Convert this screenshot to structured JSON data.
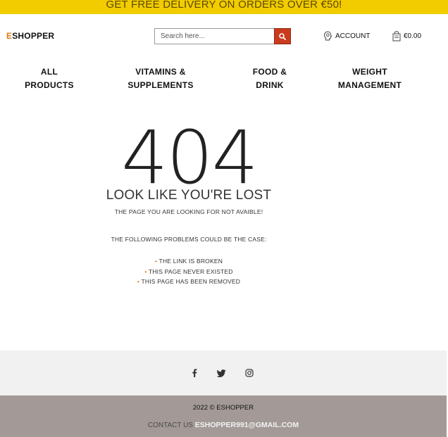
{
  "promo": {
    "text": "GET FREE DELIVERY ON ORDERS OVER €50!"
  },
  "header": {
    "logo_first": "E",
    "logo_rest": "SHOPPER",
    "search_placeholder": "Search here...",
    "search_icon": "magnifier-icon",
    "account_label": "ACCOUNT",
    "account_icon": "account-icon",
    "cart_total": "€0.00",
    "cart_icon": "cart-icon"
  },
  "nav": {
    "items": [
      {
        "line1": "ALL",
        "line2": "PRODUCTS"
      },
      {
        "line1": "VITAMINS &",
        "line2": "SUPPLEMENTS"
      },
      {
        "line1": "FOOD &",
        "line2": "DRINK"
      },
      {
        "line1": "WEIGHT",
        "line2": "MANAGEMENT"
      }
    ]
  },
  "error": {
    "code": "404",
    "title": "LOOK LIKE YOU'RE LOST",
    "subtitle": "THE PAGE YOU ARE LOOKING FOR NOT AVAIBLE!",
    "problems_heading": "THE FOLLOWING PROBLEMS COULD BE THE CASE:",
    "bullet": "•",
    "problems": [
      "THE LINK IS BROKEN",
      "THIS PAGE NEVER EXISTED",
      "THIS PAGE HAS BEEN REMOVED"
    ]
  },
  "social": {
    "icons": [
      "facebook-icon",
      "twitter-icon",
      "instagram-icon"
    ]
  },
  "footer": {
    "copyright": "2022 © ESHOPPER",
    "contact_label": "CONTACT US",
    "email": "ESHOPPER991@GMAIL.COM"
  },
  "colors": {
    "promo_bg": "#f3cc00",
    "accent_orange": "#e0771a",
    "search_button": "#cc3a1e",
    "social_bar_bg": "#f1f1f1",
    "footer_bg": "#a39a97"
  }
}
